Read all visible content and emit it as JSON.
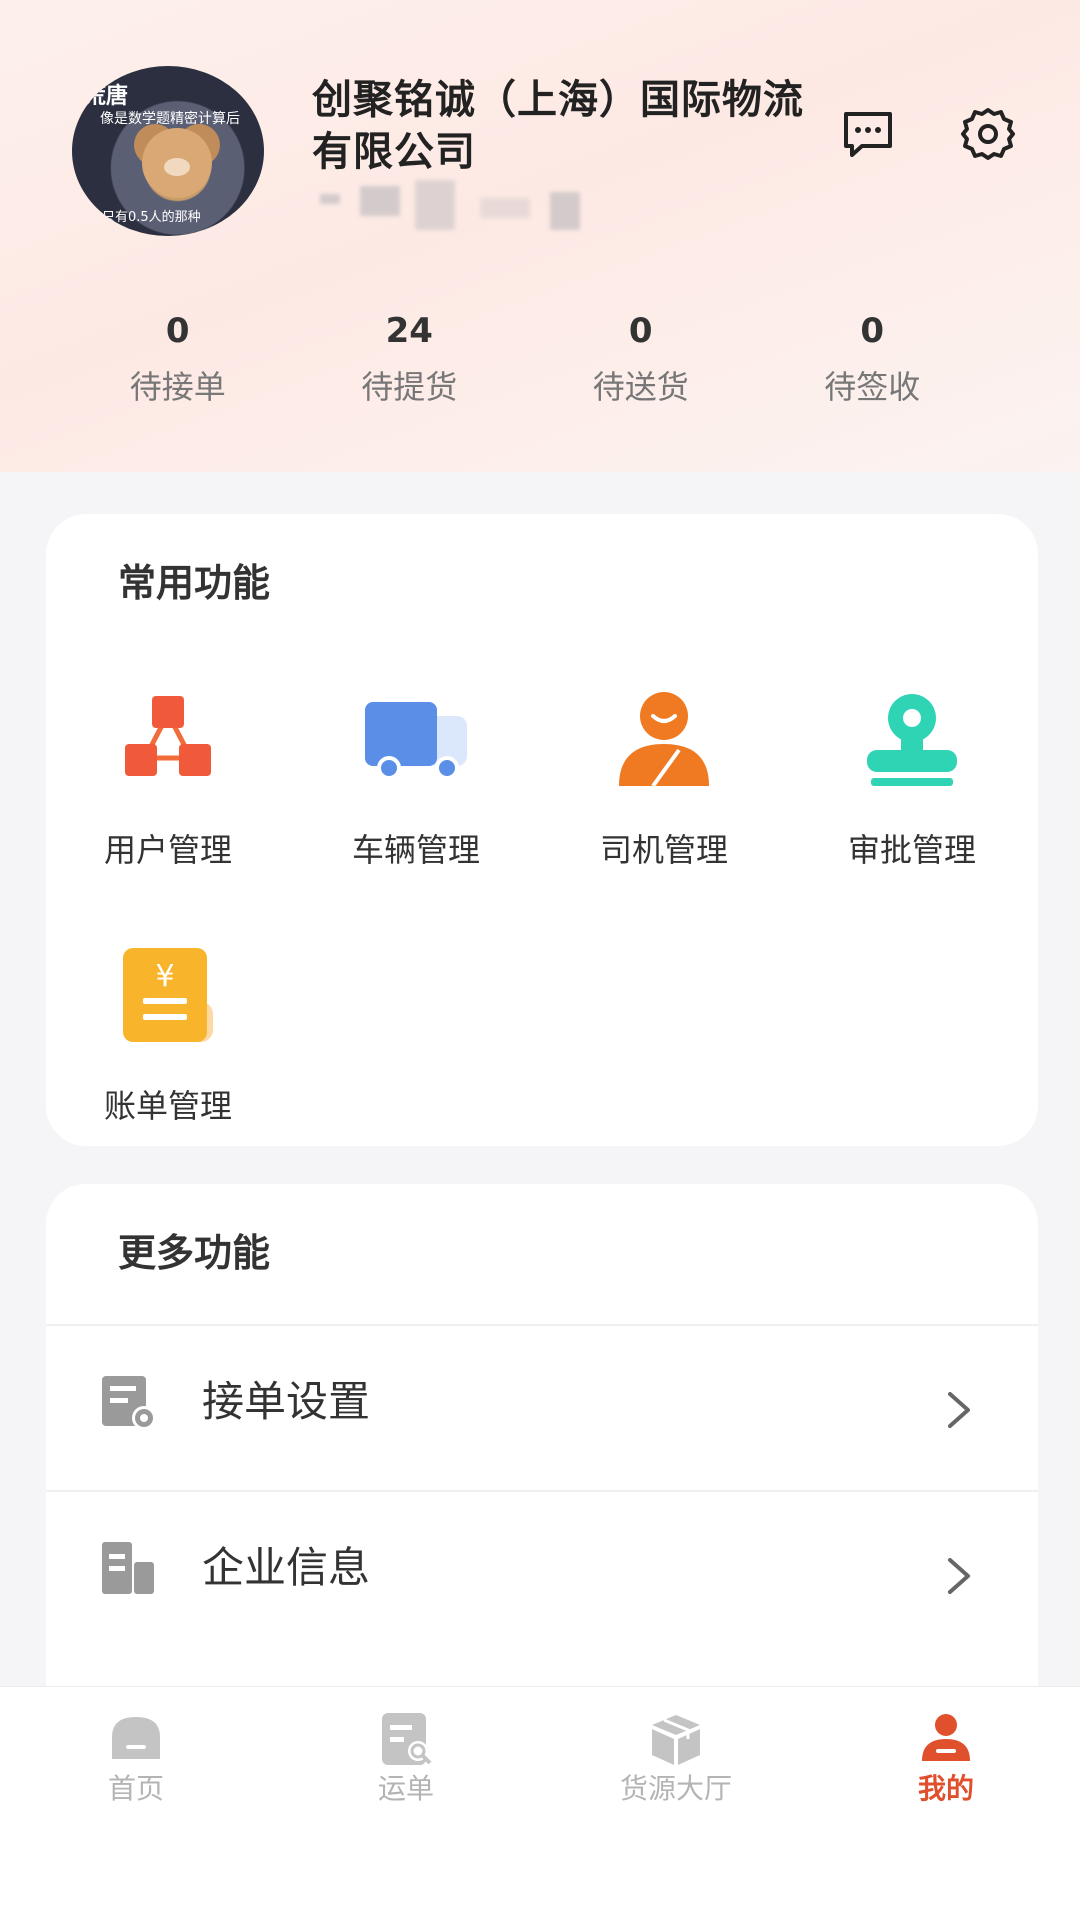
{
  "profile": {
    "avatar_text_top": "荒唐",
    "avatar_text_mid": "像是数学题精密计算后",
    "avatar_text_bottom": "只有0.5人的那种",
    "company_name": "创聚铭诚（上海）国际物流有限公司"
  },
  "stats": [
    {
      "value": "0",
      "label": "待接单"
    },
    {
      "value": "24",
      "label": "待提货"
    },
    {
      "value": "0",
      "label": "待送货"
    },
    {
      "value": "0",
      "label": "待签收"
    }
  ],
  "common": {
    "title": "常用功能",
    "items": [
      {
        "label": "用户管理",
        "icon": "org-structure-icon"
      },
      {
        "label": "车辆管理",
        "icon": "truck-icon"
      },
      {
        "label": "司机管理",
        "icon": "driver-icon"
      },
      {
        "label": "审批管理",
        "icon": "stamp-icon"
      },
      {
        "label": "账单管理",
        "icon": "bill-icon"
      }
    ]
  },
  "more": {
    "title": "更多功能",
    "rows": [
      {
        "label": "接单设置",
        "icon": "order-settings-icon"
      },
      {
        "label": "企业信息",
        "icon": "building-icon"
      }
    ]
  },
  "nav": {
    "items": [
      {
        "label": "首页",
        "icon": "home-icon"
      },
      {
        "label": "运单",
        "icon": "waybill-icon"
      },
      {
        "label": "货源大厅",
        "icon": "cargo-box-icon"
      },
      {
        "label": "我的",
        "icon": "profile-icon"
      }
    ],
    "active_index": 3
  },
  "colors": {
    "accent": "#e0502d",
    "blue": "#5b8ee6",
    "orange": "#f07a22",
    "teal": "#2fd4b4",
    "yellow": "#f8b52c"
  }
}
